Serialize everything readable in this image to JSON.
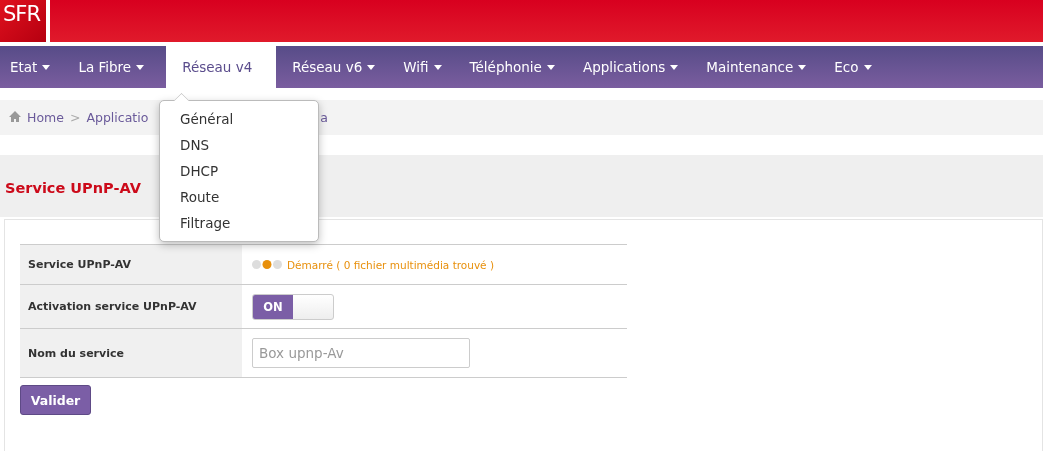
{
  "header": {
    "logo": "SFR"
  },
  "nav": [
    {
      "label": "Etat",
      "selected": false
    },
    {
      "label": "La Fibre",
      "selected": false
    },
    {
      "label": "Réseau v4",
      "selected": true
    },
    {
      "label": "Réseau v6",
      "selected": false
    },
    {
      "label": "Wifi",
      "selected": false
    },
    {
      "label": "Téléphonie",
      "selected": false
    },
    {
      "label": "Applications",
      "selected": false
    },
    {
      "label": "Maintenance",
      "selected": false
    },
    {
      "label": "Eco",
      "selected": false
    }
  ],
  "dropdown": [
    "Général",
    "DNS",
    "DHCP",
    "Route",
    "Filtrage"
  ],
  "breadcrumb": [
    "Home",
    ">",
    "Applicatio",
    "a"
  ],
  "section_title": "Service UPnP-AV",
  "form": [
    {
      "kind": "status",
      "label": "Service UPnP-AV",
      "value": "Démarré ( 0 fichier multimédia trouvé )"
    },
    {
      "kind": "toggle",
      "label": "Activation service UPnP-AV",
      "on": true,
      "value": "ON"
    },
    {
      "kind": "input",
      "label": "Nom du service",
      "placeholder": "Box upnp-Av"
    }
  ],
  "submit": "Valider"
}
